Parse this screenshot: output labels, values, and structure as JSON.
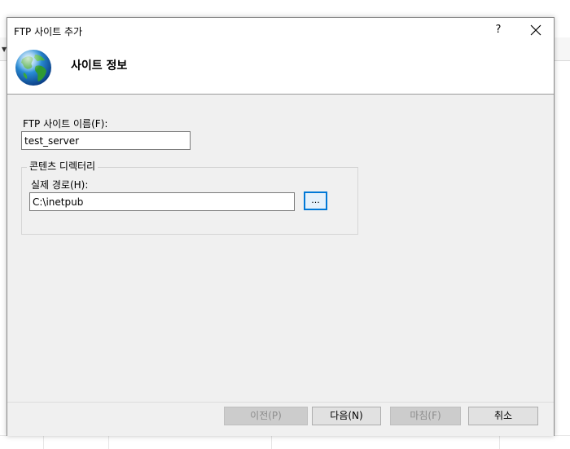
{
  "dialog": {
    "title": "FTP 사이트 추가",
    "help_label": "?",
    "page_title": "사이트 정보"
  },
  "form": {
    "site_name_label": "FTP 사이트 이름(F):",
    "site_name_value": "test_server",
    "content_dir_group": "콘텐츠 디렉터리",
    "physical_path_label": "실제 경로(H):",
    "physical_path_value": "C:\\inetpub",
    "browse_label": "..."
  },
  "footer": {
    "prev_label": "이전(P)",
    "next_label": "다음(N)",
    "finish_label": "마침(F)",
    "cancel_label": "취소"
  },
  "icons": {
    "globe": "globe-icon",
    "close": "close-icon"
  }
}
